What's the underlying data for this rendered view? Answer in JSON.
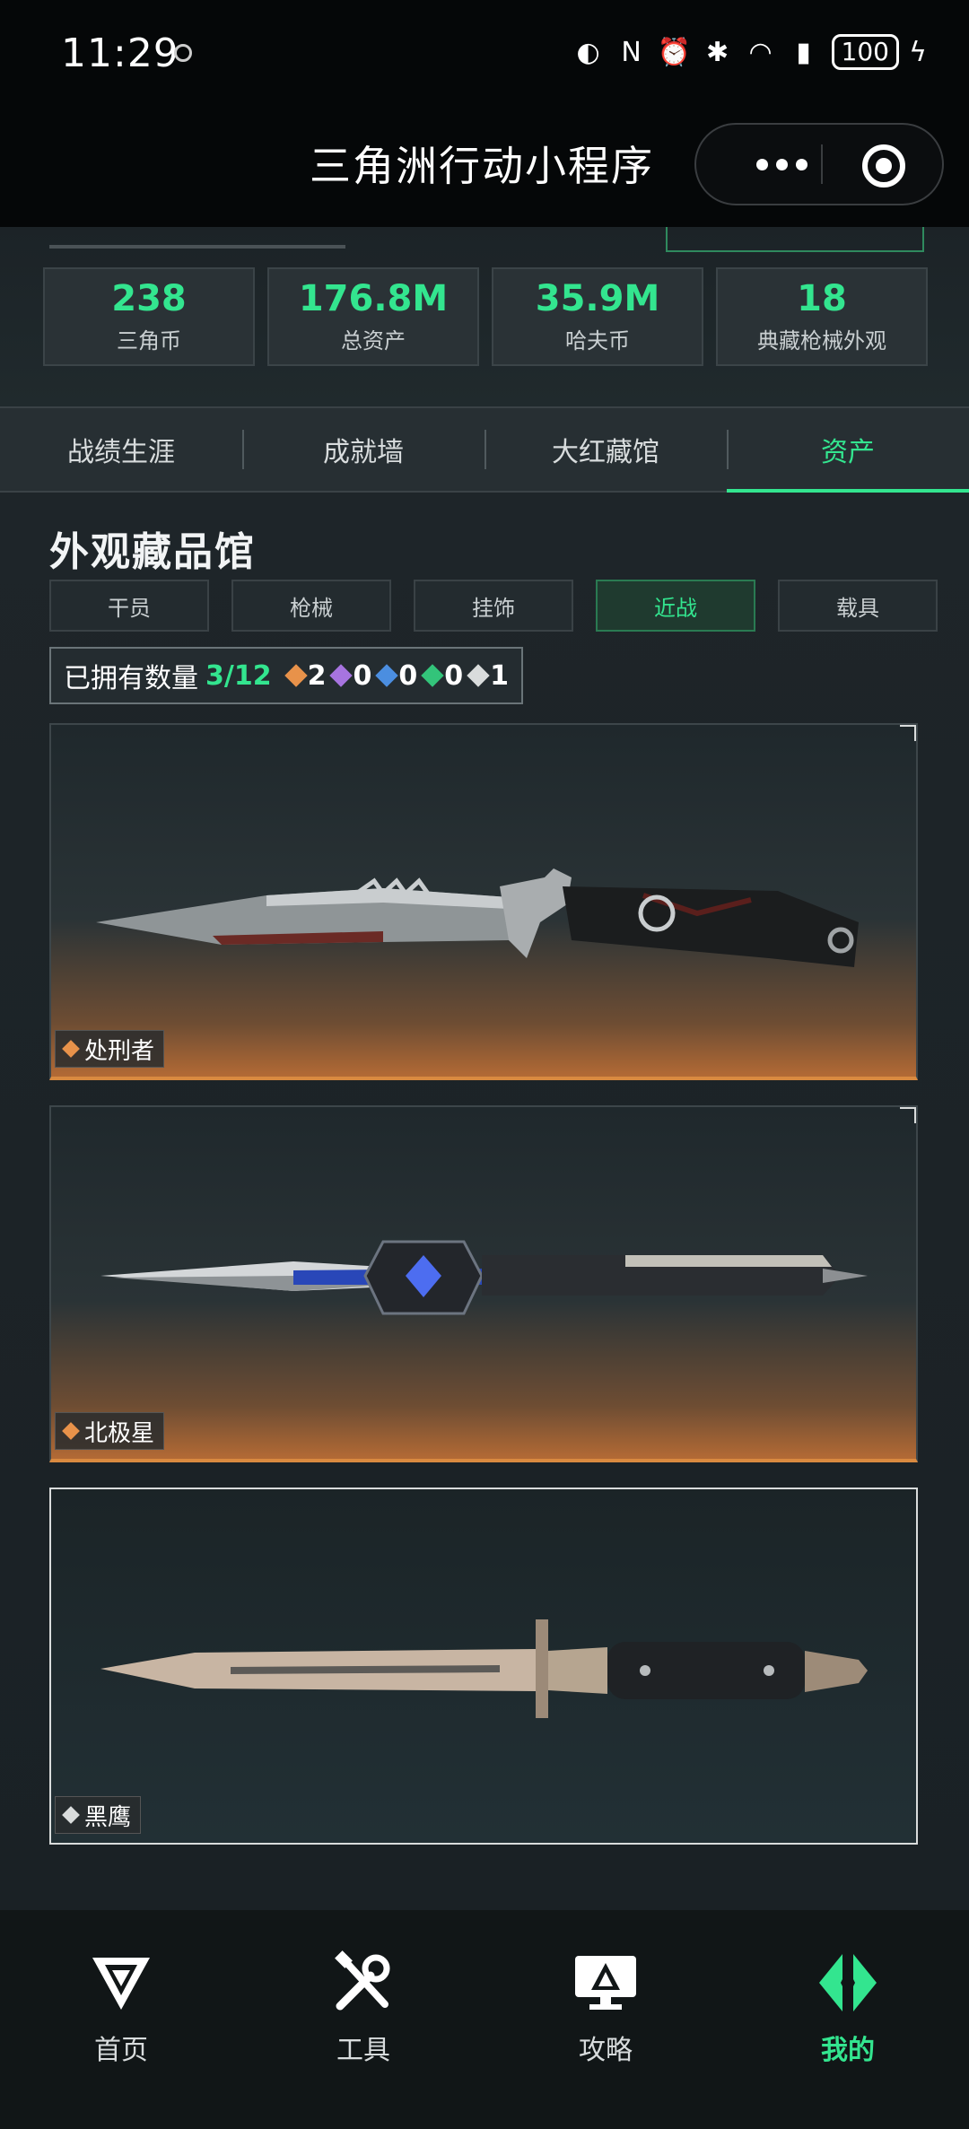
{
  "status": {
    "time": "11:29",
    "battery": "100"
  },
  "header": {
    "title": "三角洲行动小程序"
  },
  "stats": [
    {
      "value": "238",
      "label": "三角币"
    },
    {
      "value": "176.8M",
      "label": "总资产"
    },
    {
      "value": "35.9M",
      "label": "哈夫币"
    },
    {
      "value": "18",
      "label": "典藏枪械外观"
    }
  ],
  "tabs": [
    "战绩生涯",
    "成就墙",
    "大红藏馆",
    "资产"
  ],
  "section": {
    "title": "外观藏品馆"
  },
  "subtabs": [
    "干员",
    "枪械",
    "挂饰",
    "近战",
    "载具"
  ],
  "owned": {
    "label": "已拥有数量",
    "count": "3/12",
    "badges": [
      {
        "icon": "orange-diamond-icon",
        "color": "#e8924a",
        "value": "2"
      },
      {
        "icon": "purple-diamond-icon",
        "color": "#a774e0",
        "value": "0"
      },
      {
        "icon": "blue-diamond-icon",
        "color": "#4b8ee0",
        "value": "0"
      },
      {
        "icon": "green-diamond-icon",
        "color": "#33c47a",
        "value": "0"
      },
      {
        "icon": "white-diamond-icon",
        "color": "#d9dcdc",
        "value": "1"
      }
    ]
  },
  "items": [
    {
      "name": "处刑者",
      "rarity_color": "#e8924a"
    },
    {
      "name": "北极星",
      "rarity_color": "#e8924a"
    },
    {
      "name": "黑鹰",
      "rarity_color": "#d9dcdc"
    }
  ],
  "nav": [
    {
      "label": "首页",
      "icon": "home-logo-icon"
    },
    {
      "label": "工具",
      "icon": "tools-icon"
    },
    {
      "label": "攻略",
      "icon": "guide-monitor-icon"
    },
    {
      "label": "我的",
      "icon": "profile-logo-icon"
    }
  ],
  "colors": {
    "accent": "#33e58f",
    "background": "#1b2125"
  }
}
